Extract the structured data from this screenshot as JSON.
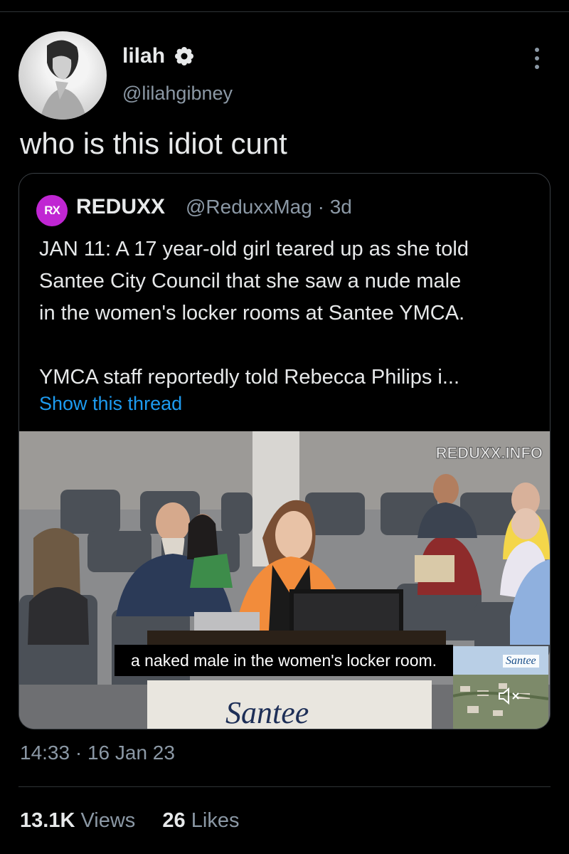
{
  "tweet": {
    "author_name": "lilah",
    "author_handle": "@lilahgibney",
    "text": "who is this idiot cunt",
    "timestamp": "14:33 · 16 Jan 23",
    "views_count": "13.1K",
    "views_label": "Views",
    "likes_count": "26",
    "likes_label": "Likes"
  },
  "quoted_tweet": {
    "avatar_text": "RX",
    "author_name": "REDUXX",
    "author_handle_time": "@ReduxxMag · 3d",
    "text_lines": [
      "JAN 11: A 17 year-old girl teared up as she told",
      "Santee City Council that she saw a nude male",
      "in the women's locker rooms at Santee YMCA."
    ],
    "text_line_2": "YMCA staff reportedly told Rebecca Philips i...",
    "show_thread": "Show this thread",
    "video": {
      "watermark": "REDUXX.INFO",
      "caption": "a naked male in the women's locker room.",
      "sign_text": "Santee",
      "inset_logo": "Santee"
    }
  },
  "colors": {
    "background": "#000000",
    "link": "#1d9bf0",
    "secondary_text": "#8b98a5",
    "primary_text": "#e7e9ea",
    "quote_avatar": "#c026d3"
  },
  "icons": [
    "verified-icon",
    "more-icon",
    "mute-icon"
  ]
}
